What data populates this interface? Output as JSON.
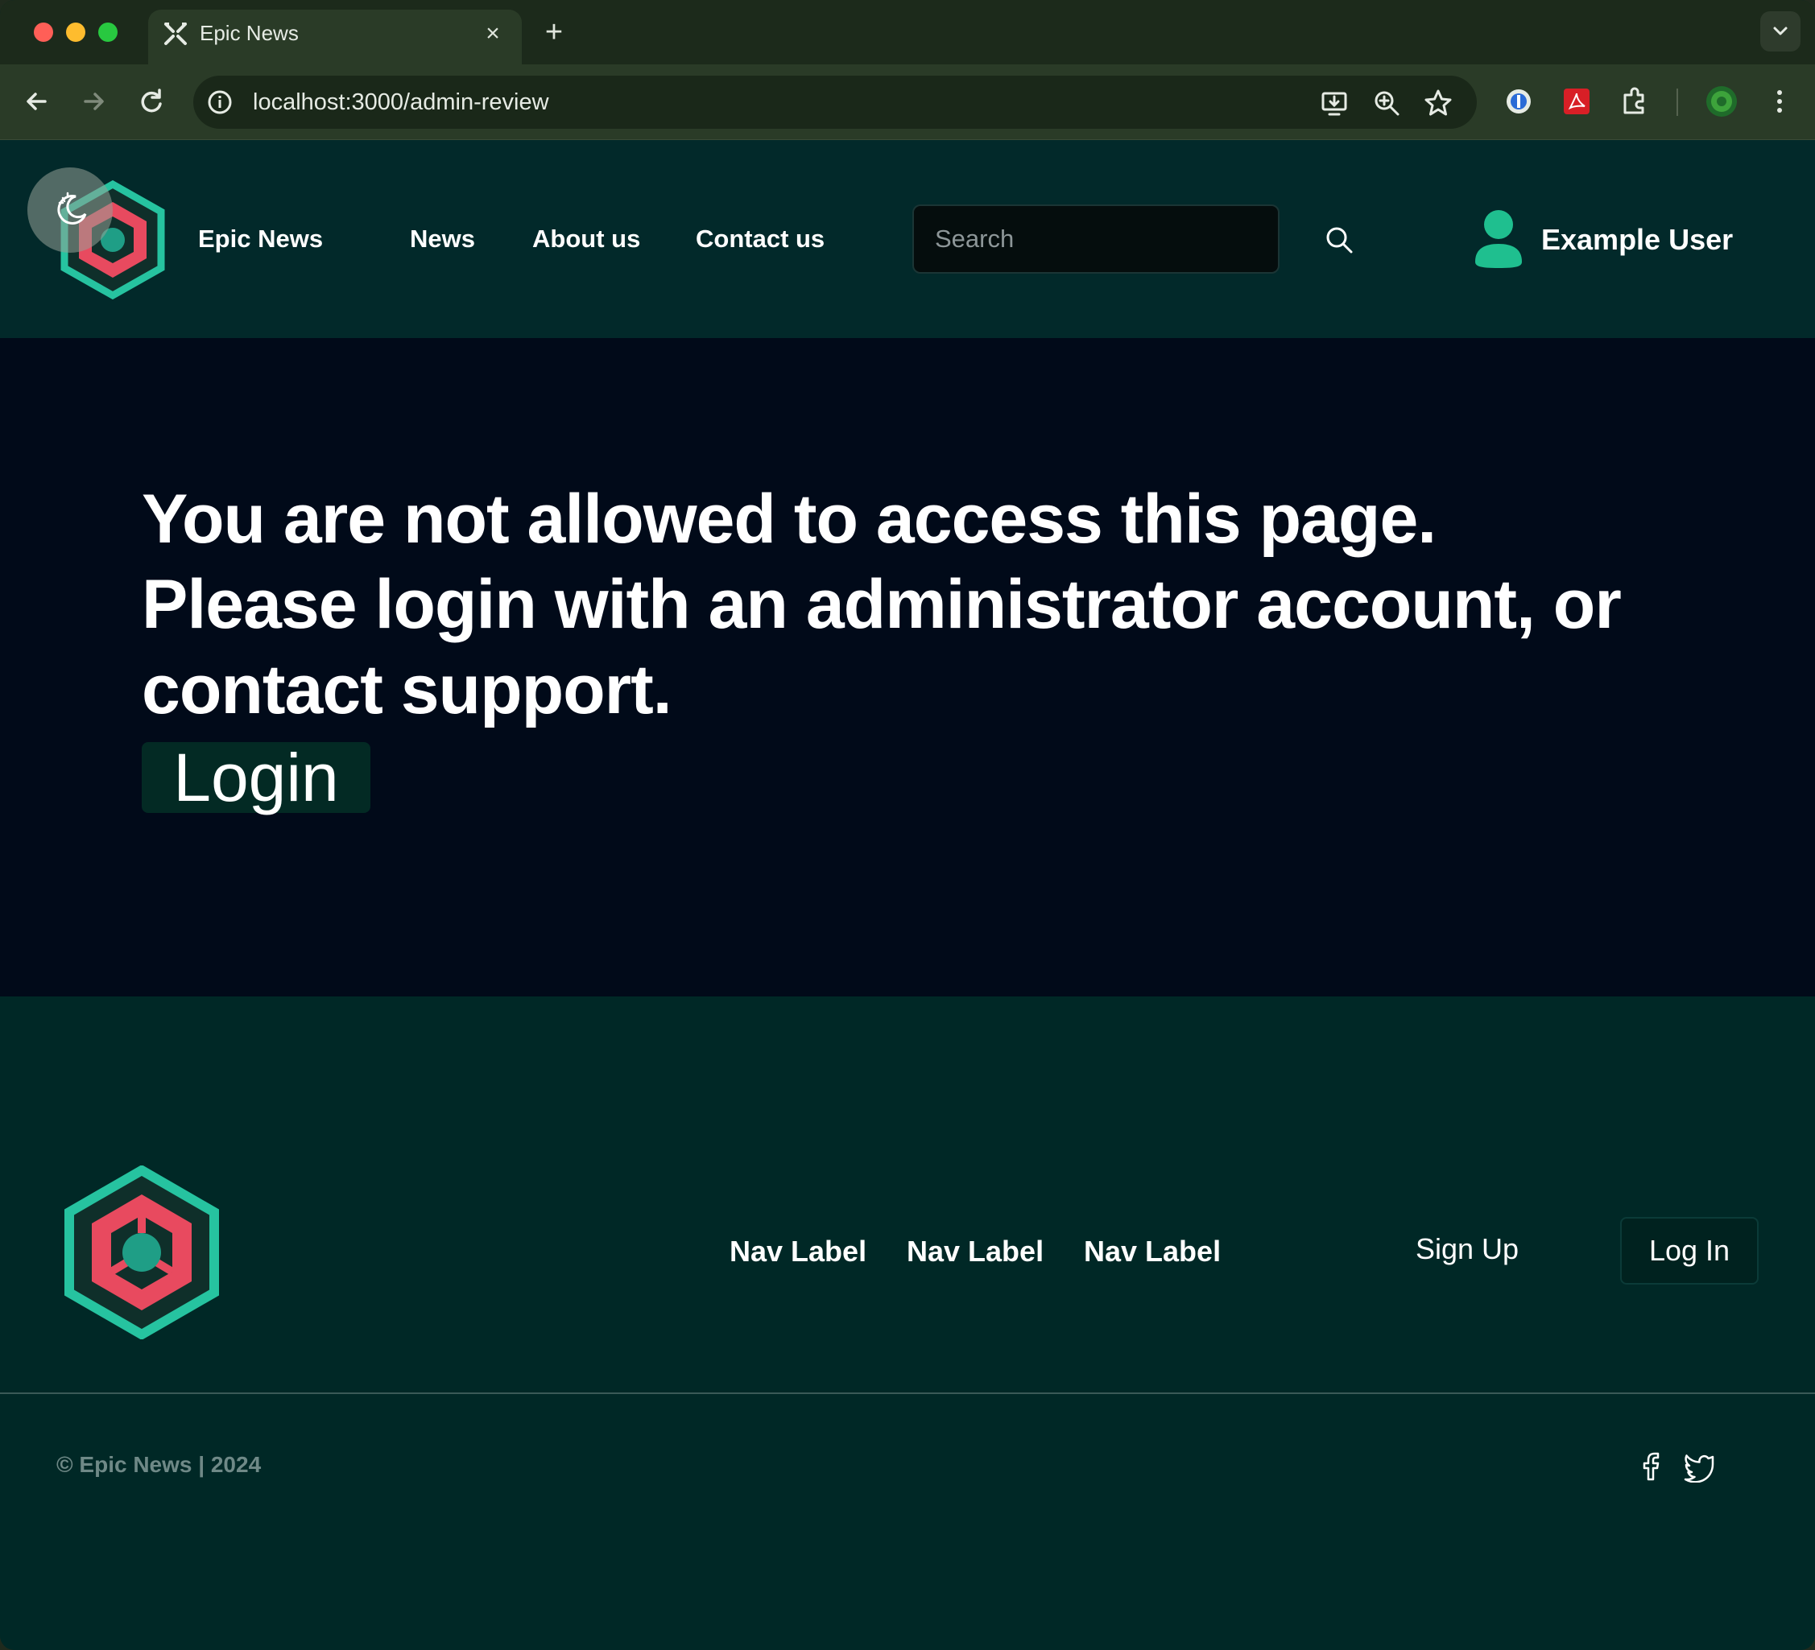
{
  "browser": {
    "tab_title": "Epic News",
    "url": "localhost:3000/admin-review",
    "icons": [
      "back-arrow-icon",
      "forward-arrow-icon",
      "reload-icon",
      "site-info-icon",
      "install-app-icon",
      "zoom-icon",
      "bookmark-star-icon",
      "password-manager-icon",
      "pdf-extension-icon",
      "extensions-puzzle-icon",
      "profile-icon",
      "menu-dots-icon"
    ]
  },
  "header": {
    "brand": "Epic News",
    "nav": [
      "News",
      "About us",
      "Contact us"
    ],
    "search_placeholder": "Search",
    "user_name": "Example User",
    "colors": {
      "background": "#02292a",
      "accent": "#1fbf8f",
      "logo_red": "#e84a5f"
    }
  },
  "main": {
    "message_line1": "You are not allowed to access this page.",
    "message_line2": "Please login with an administrator account, or contact support.",
    "login_label": "Login",
    "colors": {
      "background": "#010a19"
    }
  },
  "footer": {
    "nav": [
      "Nav Label",
      "Nav Label",
      "Nav Label"
    ],
    "signup_label": "Sign Up",
    "login_label": "Log In",
    "copyright": "© Epic News | 2024",
    "social_icons": [
      "facebook-icon",
      "twitter-icon"
    ],
    "colors": {
      "background": "#002826"
    }
  }
}
